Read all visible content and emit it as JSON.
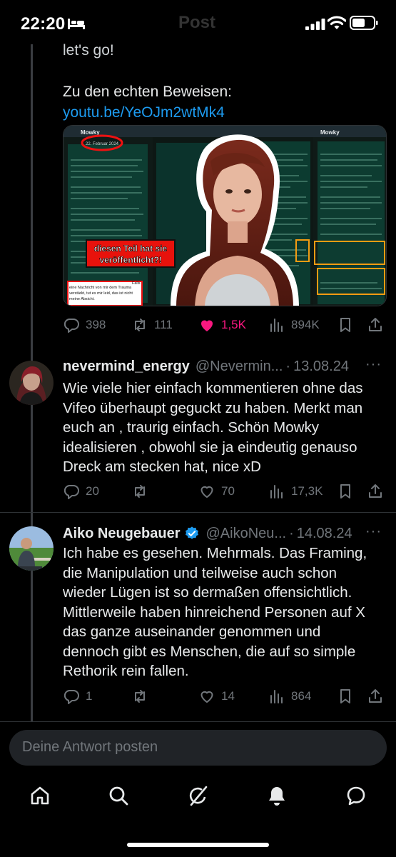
{
  "status_bar": {
    "time": "22:20",
    "ghost_title": "Post"
  },
  "main_post": {
    "text_tail": "let's go!",
    "proof_label": "Zu den echten Beweisen:",
    "proof_link": "youtu.be/YeOJm2wtMk4",
    "media": {
      "chat_name": "Mowky",
      "date_badge": "22. Februar 2024",
      "overlay_text_line1": "diesen Teil hat sie",
      "overlay_text_line2": "veröffentlicht?!",
      "quote_line1": "Falls",
      "quote_line2": "eine Nachricht von mir dem Trauma",
      "quote_line3": "verstärkt, tut es mir leid, das ist nicht",
      "quote_line4": "meine Absicht."
    },
    "stats": {
      "replies": "398",
      "reposts": "111",
      "likes": "1,5K",
      "views": "894K"
    }
  },
  "replies": [
    {
      "name": "nevermind_energy",
      "handle": "@Nevermin...",
      "date": "13.08.24",
      "text": "Wie viele hier einfach kommentieren ohne das Vifeo überhaupt geguckt zu haben. Merkt man euch an , traurig einfach. Schön Mowky idealisieren , obwohl sie ja eindeutig genauso Dreck am stecken hat, nice xD",
      "stats": {
        "replies": "20",
        "reposts": "",
        "likes": "70",
        "views": "17,3K"
      }
    },
    {
      "name": "Aiko Neugebauer",
      "handle": "@AikoNeu...",
      "date": "14.08.24",
      "verified": true,
      "text": "Ich habe es gesehen. Mehrmals. Das Framing, die Manipulation und teilweise auch schon wieder Lügen ist so dermaßen offensichtlich. Mittlerweile haben hinreichend Personen auf X das ganze auseinander genommen und dennoch gibt es Menschen, die auf so simple Rethorik rein fallen.",
      "stats": {
        "replies": "1",
        "reposts": "",
        "likes": "14",
        "views": "864"
      }
    }
  ],
  "compose": {
    "placeholder": "Deine Antwort posten"
  },
  "colors": {
    "accent": "#1d9bf0",
    "like": "#f91880",
    "muted": "#71767b",
    "bg": "#000000"
  },
  "icons": [
    "reply-icon",
    "repost-icon",
    "like-icon",
    "views-icon",
    "bookmark-icon",
    "share-icon",
    "home-icon",
    "search-icon",
    "grok-icon",
    "notifications-icon",
    "messages-icon"
  ]
}
